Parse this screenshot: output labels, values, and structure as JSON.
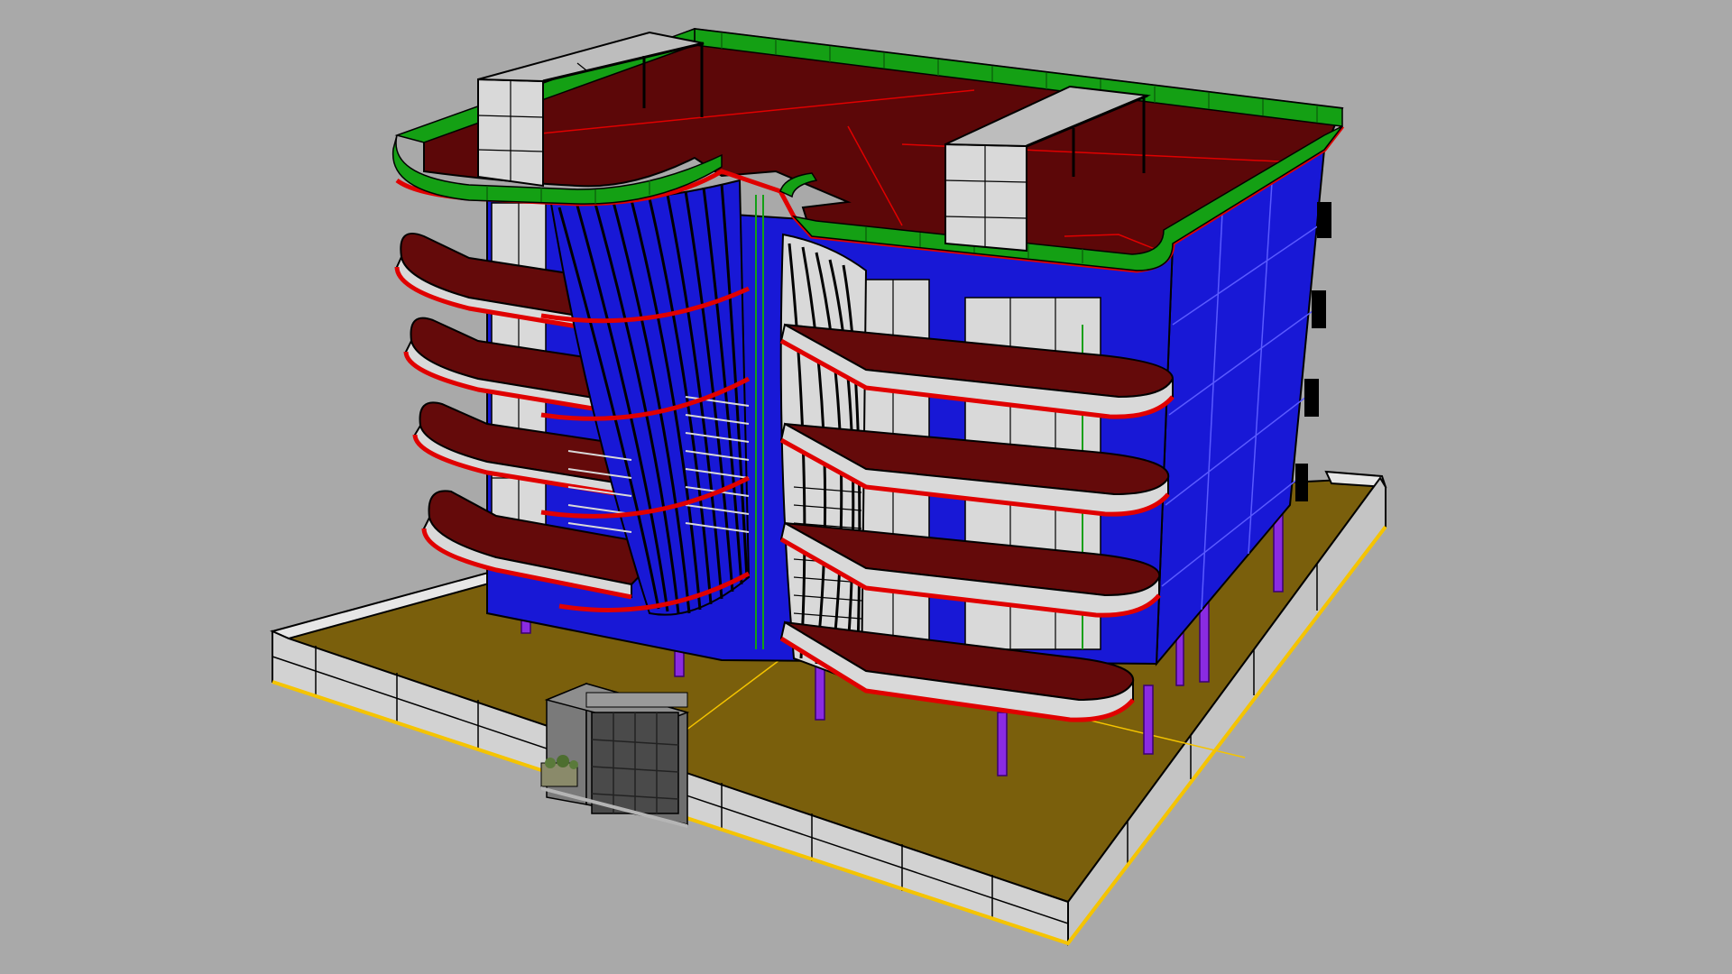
{
  "viewport": {
    "view": "perspective",
    "background_color": "#a9a9a9",
    "render_mode": "shaded-with-edges"
  },
  "model": {
    "subject": "four-storey-apartment-building-with-curved-balconies",
    "floors_with_balconies": 4,
    "colors": {
      "site_ground": "#7a5f0c",
      "boundary_wall": "#d2d2d2",
      "boundary_edge_highlight": "#f5c400",
      "roof_slab": "#5c0708",
      "balcony_slab": "#640a0a",
      "slab_edge": "#e00000",
      "parapet_railing": "#14a014",
      "glass_facade": "#1818d6",
      "wall_panels": "#d9d9d9",
      "columns": "#8a2be2",
      "louvres": "#000000",
      "gate": "#6e6e6e",
      "stair_core": "#bdbdbd"
    }
  }
}
